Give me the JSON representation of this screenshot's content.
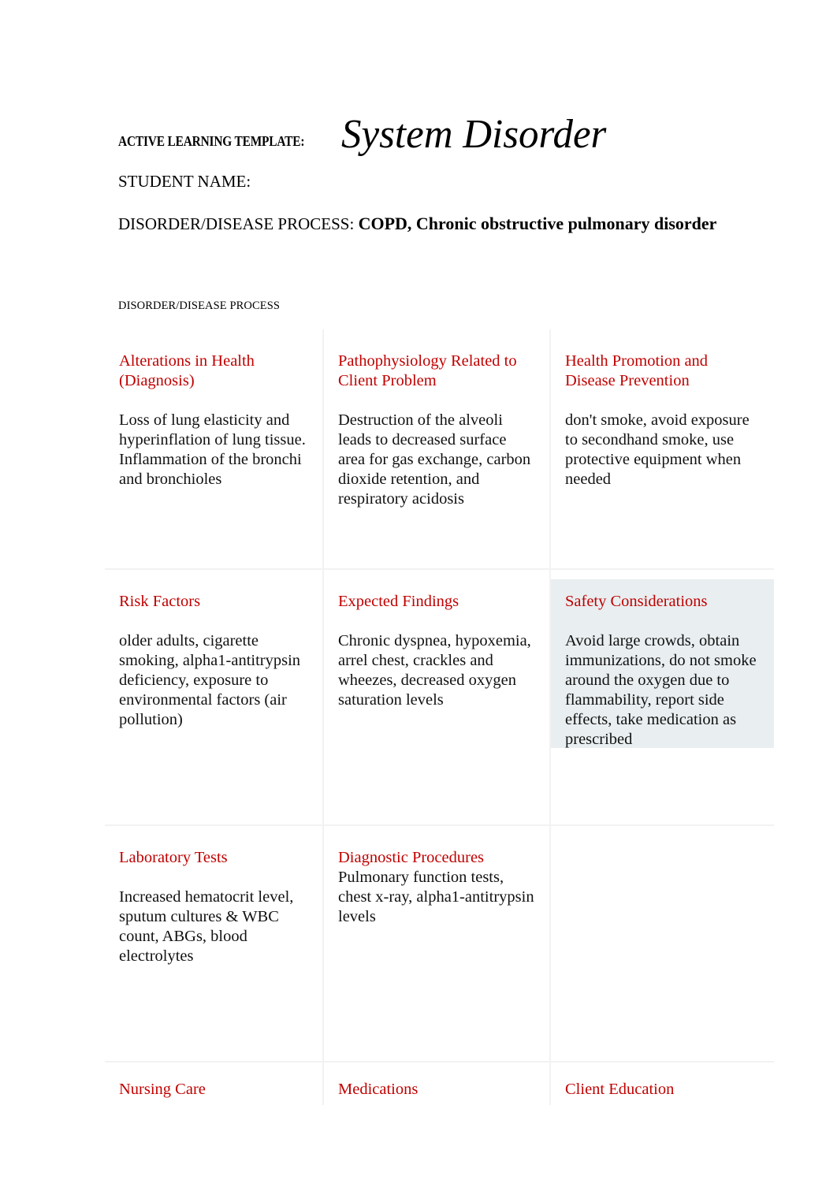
{
  "document": {
    "template_label": "ACTIVE LEARNING TEMPLATE:",
    "title": "System Disorder",
    "student_name_label": "STUDENT NAME:",
    "student_name_value": "",
    "disorder_label": "DISORDER/DISEASE PROCESS:",
    "disorder_value": "COPD, Chronic obstructive pulmonary disorder",
    "section_label": "DISORDER/DISEASE PROCESS"
  },
  "colors": {
    "heading_red": "#C00000",
    "body_text": "#111111",
    "cell_border": "#F2F2F2",
    "highlight": "#E9EEF0"
  },
  "table": {
    "rows": [
      {
        "cells": [
          {
            "title": "Alterations in Health (Diagnosis)",
            "body": "Loss of lung elasticity and hyperinflation of lung tissue. Inflammation of the bronchi and bronchioles",
            "highlighted": false
          },
          {
            "title": "Pathophysiology Related to Client Problem",
            "body": "Destruction of the alveoli leads to decreased surface area for gas exchange, carbon dioxide retention, and respiratory acidosis",
            "highlighted": false
          },
          {
            "title": "Health Promotion and Disease Prevention",
            "body": "don't smoke, avoid exposure to secondhand smoke, use protective equipment when needed",
            "highlighted": false
          }
        ]
      },
      {
        "cells": [
          {
            "title": "Risk Factors",
            "body": "older adults, cigarette smoking, alpha1-antitrypsin deficiency, exposure to environmental factors (air pollution)",
            "highlighted": false
          },
          {
            "title": "Expected Findings",
            "body": "Chronic dyspnea, hypoxemia, arrel chest, crackles and wheezes, decreased oxygen saturation levels",
            "highlighted": false
          },
          {
            "title": "Safety Considerations",
            "body": "Avoid large crowds, obtain immunizations, do not smoke around the oxygen due to flammability, report side effects, take medication as prescribed",
            "highlighted": true
          }
        ]
      },
      {
        "cells": [
          {
            "title": "Laboratory Tests",
            "body": "Increased hematocrit level, sputum cultures & WBC count, ABGs, blood electrolytes",
            "highlighted": false
          },
          {
            "title": "Diagnostic Procedures",
            "body": "Pulmonary function tests, chest x-ray, alpha1-antitrypsin levels",
            "highlighted": false,
            "tight": true
          },
          {
            "title": "",
            "body": "",
            "highlighted": false
          }
        ]
      },
      {
        "cells": [
          {
            "title": "Nursing Care",
            "body": "",
            "highlighted": false
          },
          {
            "title": "Medications",
            "body": "",
            "highlighted": false
          },
          {
            "title": "Client Education",
            "body": "",
            "highlighted": false
          }
        ]
      }
    ]
  }
}
